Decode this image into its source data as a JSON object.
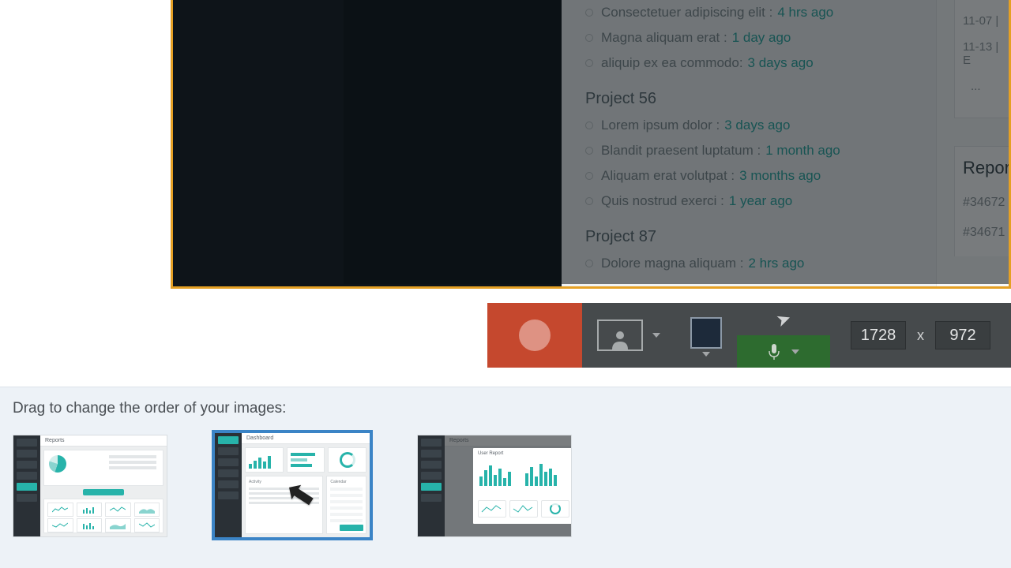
{
  "colors": {
    "accent": "#27b3aa",
    "recorder_red": "#c5482e",
    "mic_green": "#2d6b2f",
    "selection_blue": "#3b84c6",
    "frame_orange": "#e5a024"
  },
  "feed": {
    "topItems": [
      {
        "text": "Consectetuer adipiscing elit :",
        "time": "4 hrs ago"
      },
      {
        "text": "Magna aliquam erat :",
        "time": "1 day ago"
      },
      {
        "text": "aliquip ex ea commodo:",
        "time": "3 days ago"
      }
    ],
    "project56_title": "Project 56",
    "project56": [
      {
        "text": "Lorem ipsum dolor :",
        "time": "3 days ago"
      },
      {
        "text": "Blandit praesent luptatum :",
        "time": "1 month ago"
      },
      {
        "text": "Aliquam erat volutpat :",
        "time": "3 months ago"
      },
      {
        "text": "Quis nostrud exerci :",
        "time": "1 year ago"
      }
    ],
    "project87_title": "Project 87",
    "project87": [
      {
        "text": "Dolore magna aliquam :",
        "time": "2 hrs ago"
      }
    ]
  },
  "sidepanel": {
    "line1": "11-07  |",
    "line2": "11-13  |  E",
    "dots": "...",
    "reports_title": "Report",
    "id1": "#34672",
    "id2": "#34671"
  },
  "recorder": {
    "width": "1728",
    "x_label": "x",
    "height": "972"
  },
  "lower": {
    "drag_label": "Drag to change the order of your images:",
    "thumb1_header": "Reports",
    "thumb2_header": "Dashboard",
    "thumb3_header": "Reports",
    "thumb3_modal_title": "User Report"
  }
}
